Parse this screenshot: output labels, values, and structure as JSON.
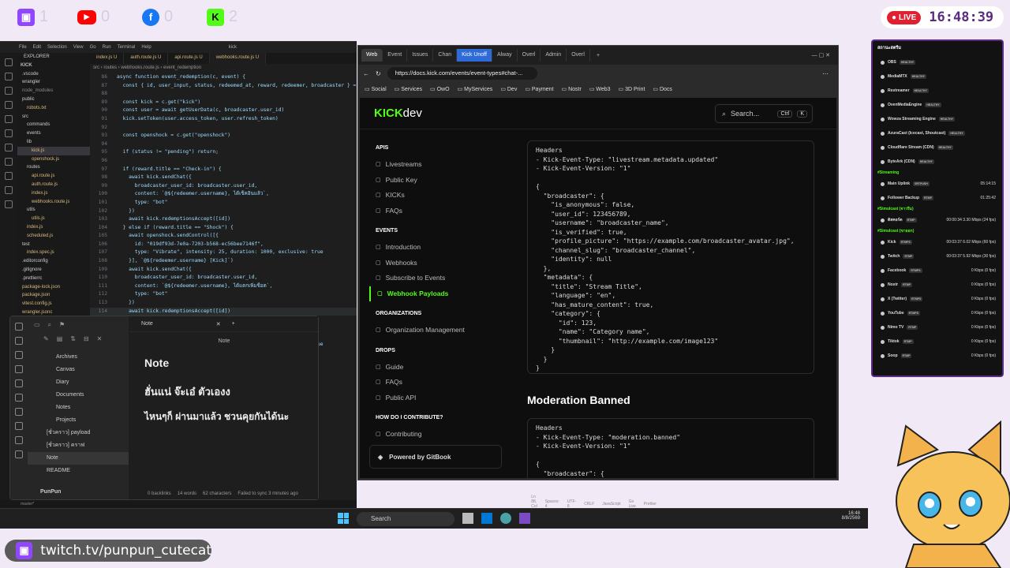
{
  "stream": {
    "twitch_count": "1",
    "youtube_count": "0",
    "facebook_count": "0",
    "kick_count": "2",
    "live_label": "LIVE",
    "clock": "16:48:39",
    "channel": "twitch.tv/punpun_cutecat"
  },
  "vscode": {
    "menu": [
      "File",
      "Edit",
      "Selection",
      "View",
      "Go",
      "Run",
      "Terminal",
      "Help"
    ],
    "search": "kick",
    "explorer_title": "EXPLORER",
    "root": "KICK",
    "files": [
      ".vscode",
      "wrangler",
      "node_modules",
      "public",
      "robots.txt",
      "src",
      "commands",
      "events",
      "lib",
      "kick.js",
      "openshock.js",
      "routes",
      "api.route.js",
      "auth.route.js",
      "index.js",
      "webhooks.route.js",
      "utils",
      "utils.js",
      "index.js",
      "scheduled.js",
      "test",
      "index.spec.js",
      ".editorconfig",
      ".gitignore",
      ".prettierrc",
      "package-lock.json",
      "package.json",
      "vitest.config.js",
      "wrangler.jsonc"
    ],
    "tabs": [
      "index.js U",
      "auth.route.js U",
      "api.route.js U",
      "webhooks.route.js U"
    ],
    "breadcrumb": "src › routes › webhooks.route.js › event_redemption",
    "lines": [
      {
        "n": "86",
        "t": "async function event_redemption(c, event) {"
      },
      {
        "n": "87",
        "t": "  const { id, user_input, status, redeemed_at, reward, redeemer, broadcaster } = e"
      },
      {
        "n": "88",
        "t": ""
      },
      {
        "n": "89",
        "t": "  const kick = c.get(\"kick\")"
      },
      {
        "n": "90",
        "t": "  const user = await getUserData(c, broadcaster.user_id)"
      },
      {
        "n": "91",
        "t": "  kick.setToken(user.access_token, user.refresh_token)"
      },
      {
        "n": "92",
        "t": ""
      },
      {
        "n": "93",
        "t": "  const openshock = c.get(\"openshock\")"
      },
      {
        "n": "94",
        "t": ""
      },
      {
        "n": "95",
        "t": "  if (status != \"pending\") return;"
      },
      {
        "n": "96",
        "t": ""
      },
      {
        "n": "97",
        "t": "  if (reward.title == \"Check-in\") {"
      },
      {
        "n": "98",
        "t": "    await kick.sendChat({"
      },
      {
        "n": "99",
        "t": "      broadcaster_user_id: broadcaster.user_id,"
      },
      {
        "n": "100",
        "t": "      content: `@${redeemer.username}, ได้เช็คอินแล้ว`,"
      },
      {
        "n": "101",
        "t": "      type: \"bot\""
      },
      {
        "n": "102",
        "t": "    })"
      },
      {
        "n": "103",
        "t": "    await kick.redemptionsAccept([id])"
      },
      {
        "n": "104",
        "t": "  } else if (reward.title == \"Shock\") {"
      },
      {
        "n": "105",
        "t": "    await openshock.sendControl([{"
      },
      {
        "n": "106",
        "t": "      id: \"019df93d-7e0a-7203-b568-ec56bee7146f\","
      },
      {
        "n": "107",
        "t": "      type: \"Vibrate\", intensity: 25, duration: 1000, exclusive: true"
      },
      {
        "n": "108",
        "t": "    }], `@${redeemer.username} [Kick]`)"
      },
      {
        "n": "109",
        "t": "    await kick.sendChat({"
      },
      {
        "n": "110",
        "t": "      broadcaster_user_id: broadcaster.user_id,"
      },
      {
        "n": "111",
        "t": "      content: `@${redeemer.username}, ได้แตกเพิ่มช็อต`,"
      },
      {
        "n": "112",
        "t": "      type: \"bot\""
      },
      {
        "n": "113",
        "t": "    })"
      },
      {
        "n": "114",
        "t": "    await kick.redemptionsAccept([id])"
      },
      {
        "n": "115",
        "t": "  } else if (reward.title == \"Vibrate\") {"
      },
      {
        "n": "116",
        "t": "    await openshock.sendControl([{"
      },
      {
        "n": "117",
        "t": "      id: \"019df93d-7e0a-7203-b568-ec56bee7146f\","
      },
      {
        "n": "118",
        "t": "      type: \"Vibrate\", intensity: 25, duration: 1000, exclusive: true"
      }
    ],
    "status": [
      "master*",
      "Ln 88, Col 34",
      "Spaces: 4",
      "UTF-8",
      "CRLF",
      "JavaScript",
      "Go Live",
      "Prettier"
    ]
  },
  "obsidian": {
    "tab": "Note",
    "header": "Note",
    "tree": [
      "Archives",
      "Canvas",
      "Diary",
      "Documents",
      "Notes",
      "Projects",
      "[ชั่วคราว] payload",
      "[ชั่วคราว] คราฟ",
      "Note",
      "README"
    ],
    "vault": "PunPun",
    "title": "Note",
    "line1": "ฮั่นแน่ จ๊ะเอ๋ ตัวเองง",
    "line2": "ไหนๆก็ ผ่านมาแล้ว ชวนคุยกันได้นะ",
    "footer": [
      "0 backlinks",
      "14 words",
      "62 characters",
      "Failed to sync 3 minutes ago"
    ]
  },
  "browser": {
    "tabs": [
      "Web",
      "Event",
      "Issues",
      "Chan",
      "Kick Unoff",
      "Alway",
      "Overl",
      "Admin",
      "Overl"
    ],
    "url": "https://docs.kick.com/events/event-types#chat-...",
    "bookmarks": [
      "Social",
      "Services",
      "OwO",
      "MyServices",
      "Dev",
      "Payment",
      "Nostr",
      "Web3",
      "3D Print",
      "Docs"
    ],
    "logo_main": "KICK",
    "logo_sub": "dev",
    "search": "Search...",
    "kbd1": "Ctrl",
    "kbd2": "K",
    "nav": [
      {
        "section": "APIS",
        "items": [
          "Livestreams",
          "Public Key",
          "KICKs",
          "FAQs"
        ]
      },
      {
        "section": "EVENTS",
        "items": [
          "Introduction",
          "Webhooks",
          "Subscribe to Events",
          "Webhook Payloads"
        ]
      },
      {
        "section": "ORGANIZATIONS",
        "items": [
          "Organization Management"
        ]
      },
      {
        "section": "DROPS",
        "items": [
          "Guide",
          "FAQs",
          "Public API"
        ]
      },
      {
        "section": "HOW DO I CONTRIBUTE?",
        "items": [
          "Contributing"
        ]
      }
    ],
    "powered": "Powered by GitBook",
    "block1": "Headers\n- Kick-Event-Type: \"livestream.metadata.updated\"\n- Kick-Event-Version: \"1\"\n\n{\n  \"broadcaster\": {\n    \"is_anonymous\": false,\n    \"user_id\": 123456789,\n    \"username\": \"broadcaster_name\",\n    \"is_verified\": true,\n    \"profile_picture\": \"https://example.com/broadcaster_avatar.jpg\",\n    \"channel_slug\": \"broadcaster_channel\",\n    \"identity\": null\n  },\n  \"metadata\": {\n    \"title\": \"Stream Title\",\n    \"language\": \"en\",\n    \"has_mature_content\": true,\n    \"category\": {\n      \"id\": 123,\n      \"name\": \"Category name\",\n      \"thumbnail\": \"http://example.com/image123\"\n    }\n  }\n}",
    "heading2": "Moderation Banned",
    "block2": "Headers\n- Kick-Event-Type: \"moderation.banned\"\n- Kick-Event-Version: \"1\"\n\n{\n  \"broadcaster\": {"
  },
  "panel": {
    "title": "สถานะสตรีม",
    "services": [
      "OBS",
      "MediaMTX",
      "Restreamer",
      "OvenMediaEngine",
      "Wowza Streaming Engine",
      "AzuraCast (Icecast, Shoutcast)",
      "Cloudflare Stream (CDN)",
      "ByteArk (CDN)"
    ],
    "badge": "HEALTHY",
    "group1": "#Streaming",
    "streaming": [
      {
        "name": "Main Uplink",
        "badge": "SRTPUSH",
        "val": "05:14:15"
      },
      {
        "name": "Follower Backup",
        "badge": "RTMP",
        "val": "01:25:42"
      }
    ],
    "group2": "#Simulcast (จาวรีม)",
    "sim1": [
      {
        "name": "ดิสคอร์ด",
        "badge": "RTMP",
        "val": "00:00:34  3.30 Mbps  (24 fps)"
      }
    ],
    "group3": "#Simulcast (ขาออก)",
    "sim2": [
      {
        "name": "Kick",
        "badge": "RTMPS",
        "val": "00:03:37  6.02 Mbps  (60 fps)"
      },
      {
        "name": "Twitch",
        "badge": "RTMP",
        "val": "00:03:37  5.92 Mbps  (30 fps)"
      },
      {
        "name": "Facebook",
        "badge": "RTMPS",
        "val": "0 Kbps  (0 fps)"
      },
      {
        "name": "Nostr",
        "badge": "RTMP",
        "val": "0 Kbps  (0 fps)"
      },
      {
        "name": "X (Twitter)",
        "badge": "RTMPS",
        "val": "0 Kbps  (0 fps)"
      },
      {
        "name": "YouTube",
        "badge": "RTMPS",
        "val": "0 Kbps  (0 fps)"
      },
      {
        "name": "Nimo TV",
        "badge": "RTMP",
        "val": "0 Kbps  (0 fps)"
      },
      {
        "name": "Tiktok",
        "badge": "RTMP",
        "val": "0 Kbps  (0 fps)"
      },
      {
        "name": "Soop",
        "badge": "RTMP",
        "val": "0 Kbps  (0 fps)"
      }
    ]
  },
  "taskbar": {
    "search": "Search",
    "time": "16:48",
    "date": "8/8/2569"
  }
}
